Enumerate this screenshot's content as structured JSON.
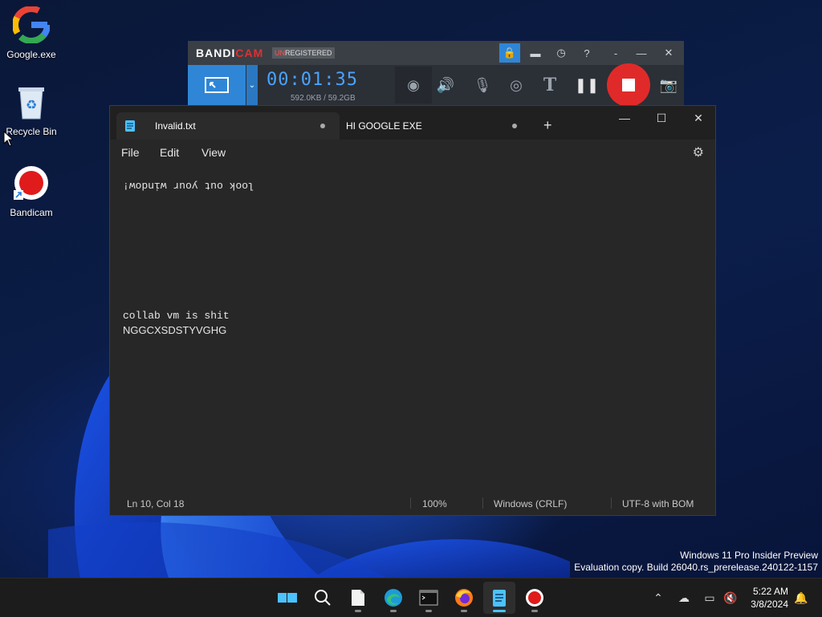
{
  "desktop": {
    "icons": [
      {
        "label": "Google.exe",
        "icon": "google-icon"
      },
      {
        "label": "Recycle Bin",
        "icon": "recycle-bin-icon"
      },
      {
        "label": "Bandicam",
        "icon": "bandicam-icon"
      }
    ],
    "watermark": {
      "line1": "Windows 11 Pro Insider Preview",
      "line2": "Evaluation copy. Build 26040.rs_prerelease.240122-1157"
    }
  },
  "bandicam": {
    "brand_a": "BANDI",
    "brand_b": "CAM",
    "reg_a": "UN",
    "reg_b": "REGISTERED",
    "timer": "00:01:35",
    "size": "592.0KB / 59.2GB",
    "colors": {
      "accent": "#2f86d6",
      "record": "#e02a2a"
    }
  },
  "notepad": {
    "tabs": [
      {
        "label": "Invalid.txt",
        "active": true
      },
      {
        "label": "HI GOOGLE EXE",
        "active": false
      }
    ],
    "new_tab": "+",
    "menu": {
      "file": "File",
      "edit": "Edit",
      "view": "View"
    },
    "lines": {
      "upside": "look out your window!",
      "l10a": "collab vm is shit",
      "l10b": "NGGCXSDSTYVGHG"
    },
    "status": {
      "position": "Ln 10, Col 18",
      "zoom": "100%",
      "eol": "Windows (CRLF)",
      "encoding": "UTF-8 with BOM"
    }
  },
  "taskbar": {
    "apps": [
      "start-icon",
      "search-icon",
      "file-explorer-icon",
      "edge-icon",
      "terminal-icon",
      "firefox-icon",
      "notepad-icon",
      "bandicam-icon"
    ],
    "clock": {
      "time": "5:22 AM",
      "date": "3/8/2024"
    }
  }
}
